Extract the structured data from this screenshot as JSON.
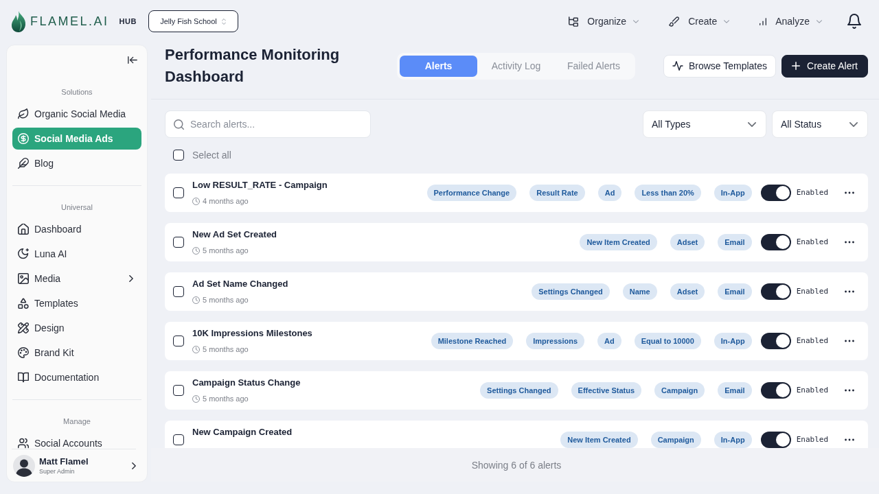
{
  "header": {
    "logo_text": "FLAMEL.AI",
    "hub_label": "HUB",
    "workspace": "Jelly Fish School",
    "menus": [
      {
        "label": "Organize"
      },
      {
        "label": "Create"
      },
      {
        "label": "Analyze"
      }
    ]
  },
  "sidebar": {
    "sections": [
      {
        "title": "Solutions",
        "items": [
          {
            "label": "Organic Social Media",
            "kind": "link",
            "selected": false
          },
          {
            "label": "Social Media Ads",
            "kind": "link",
            "selected": true
          },
          {
            "label": "Blog",
            "kind": "link",
            "selected": false
          }
        ]
      },
      {
        "title": "Universal",
        "items": [
          {
            "label": "Dashboard",
            "kind": "link",
            "selected": false
          },
          {
            "label": "Luna AI",
            "kind": "link",
            "selected": false
          },
          {
            "label": "Media",
            "kind": "submenu",
            "selected": false
          },
          {
            "label": "Templates",
            "kind": "link",
            "selected": false
          },
          {
            "label": "Design",
            "kind": "link",
            "selected": false
          },
          {
            "label": "Brand Kit",
            "kind": "link",
            "selected": false
          },
          {
            "label": "Documentation",
            "kind": "link",
            "selected": false
          }
        ]
      },
      {
        "title": "Manage",
        "items": [
          {
            "label": "Social Accounts",
            "kind": "link",
            "selected": false
          }
        ]
      }
    ],
    "user": {
      "name": "Matt Flamel",
      "role": "Super Admin"
    }
  },
  "page": {
    "title": "Performance Monitoring Dashboard",
    "tabs": [
      {
        "label": "Alerts",
        "selected": true
      },
      {
        "label": "Activity Log",
        "selected": false
      },
      {
        "label": "Failed Alerts",
        "selected": false
      }
    ],
    "actions": [
      {
        "label": "Browse Templates",
        "kind": "secondary"
      },
      {
        "label": "Create Alert",
        "kind": "primary"
      }
    ]
  },
  "filters": {
    "search": {
      "placeholder": "Search alerts..."
    },
    "dropdowns": [
      {
        "value": "All Types"
      },
      {
        "value": "All Status"
      }
    ],
    "select_all": {
      "label": "Select all",
      "checked": false
    }
  },
  "alerts": [
    {
      "title": "Low RESULT_RATE - Campaign",
      "time": "4 months ago",
      "checked": false,
      "tags": [
        "Performance Change",
        "Result Rate",
        "Ad",
        "Less than 20%",
        "In-App"
      ],
      "enabled": true,
      "status_label": "Enabled"
    },
    {
      "title": "New Ad Set Created",
      "time": "5 months ago",
      "checked": false,
      "tags": [
        "New Item Created",
        "Adset",
        "Email"
      ],
      "enabled": true,
      "status_label": "Enabled"
    },
    {
      "title": "Ad Set Name Changed",
      "time": "5 months ago",
      "checked": false,
      "tags": [
        "Settings Changed",
        "Name",
        "Adset",
        "Email"
      ],
      "enabled": true,
      "status_label": "Enabled"
    },
    {
      "title": "10K Impressions Milestones",
      "time": "5 months ago",
      "checked": false,
      "tags": [
        "Milestone Reached",
        "Impressions",
        "Ad",
        "Equal to 10000",
        "In-App"
      ],
      "enabled": true,
      "status_label": "Enabled"
    },
    {
      "title": "Campaign Status Change",
      "time": "5 months ago",
      "checked": false,
      "tags": [
        "Settings Changed",
        "Effective Status",
        "Campaign",
        "Email"
      ],
      "enabled": true,
      "status_label": "Enabled"
    },
    {
      "title": "New Campaign Created",
      "checked": false,
      "tags": [
        "New Item Created",
        "Campaign",
        "In-App"
      ],
      "enabled": true,
      "status_label": "Enabled"
    }
  ],
  "footer": {
    "summary": "Showing 6 of 6 alerts"
  }
}
